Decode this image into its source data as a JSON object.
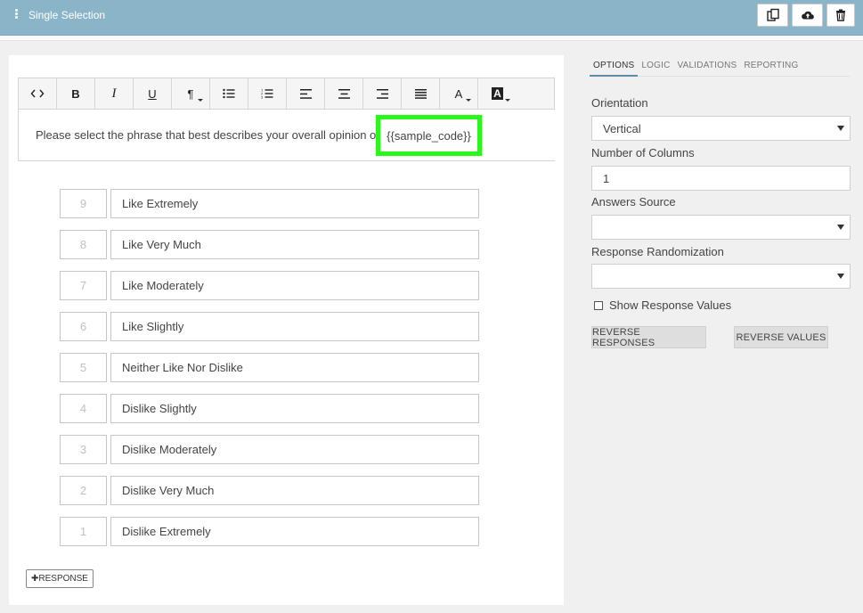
{
  "header": {
    "title": "Single Selection",
    "icons": [
      "kebab-menu-icon",
      "copy-icon",
      "cloud-upload-icon",
      "trash-icon"
    ]
  },
  "toolbar": {
    "buttons": [
      {
        "name": "code-view-button",
        "glyph": "<>"
      },
      {
        "name": "bold-button",
        "glyph": "B"
      },
      {
        "name": "italic-button",
        "glyph": "I"
      },
      {
        "name": "underline-button",
        "glyph": "U"
      },
      {
        "name": "paragraph-button",
        "glyph": "¶"
      },
      {
        "name": "bullet-list-button",
        "glyph": "bullet-list-icon"
      },
      {
        "name": "numbered-list-button",
        "glyph": "numbered-list-icon"
      },
      {
        "name": "align-left-button",
        "glyph": "align-left-icon"
      },
      {
        "name": "align-center-button",
        "glyph": "align-center-icon"
      },
      {
        "name": "align-right-button",
        "glyph": "align-right-icon"
      },
      {
        "name": "align-justify-button",
        "glyph": "align-justify-icon"
      },
      {
        "name": "font-color-button",
        "glyph": "A"
      },
      {
        "name": "highlight-color-button",
        "glyph": "A"
      }
    ]
  },
  "editor": {
    "question_text": "Please select the phrase that best describes your overall opinion of",
    "placeholder_code": "{{sample_code}}"
  },
  "responses": [
    {
      "value": "9",
      "label": "Like Extremely"
    },
    {
      "value": "8",
      "label": "Like Very Much"
    },
    {
      "value": "7",
      "label": "Like Moderately"
    },
    {
      "value": "6",
      "label": "Like Slightly"
    },
    {
      "value": "5",
      "label": "Neither Like Nor Dislike"
    },
    {
      "value": "4",
      "label": "Dislike Slightly"
    },
    {
      "value": "3",
      "label": "Dislike Moderately"
    },
    {
      "value": "2",
      "label": "Dislike Very Much"
    },
    {
      "value": "1",
      "label": "Dislike Extremely"
    }
  ],
  "add_response_label": "✚RESPONSE",
  "options": {
    "tabs": [
      "OPTIONS",
      "LOGIC",
      "VALIDATIONS",
      "REPORTING"
    ],
    "active_tab": "OPTIONS",
    "orientation_label": "Orientation",
    "orientation_value": "Vertical",
    "columns_label": "Number of Columns",
    "columns_value": "1",
    "answers_source_label": "Answers Source",
    "answers_source_value": "",
    "randomization_label": "Response Randomization",
    "randomization_value": "",
    "show_values_label": "Show Response Values",
    "show_values_checked": false,
    "reverse_responses_label": "REVERSE RESPONSES",
    "reverse_values_label": "REVERSE VALUES"
  },
  "colors": {
    "header_bg": "#8ab5c9",
    "highlight_border": "#29f81a"
  }
}
